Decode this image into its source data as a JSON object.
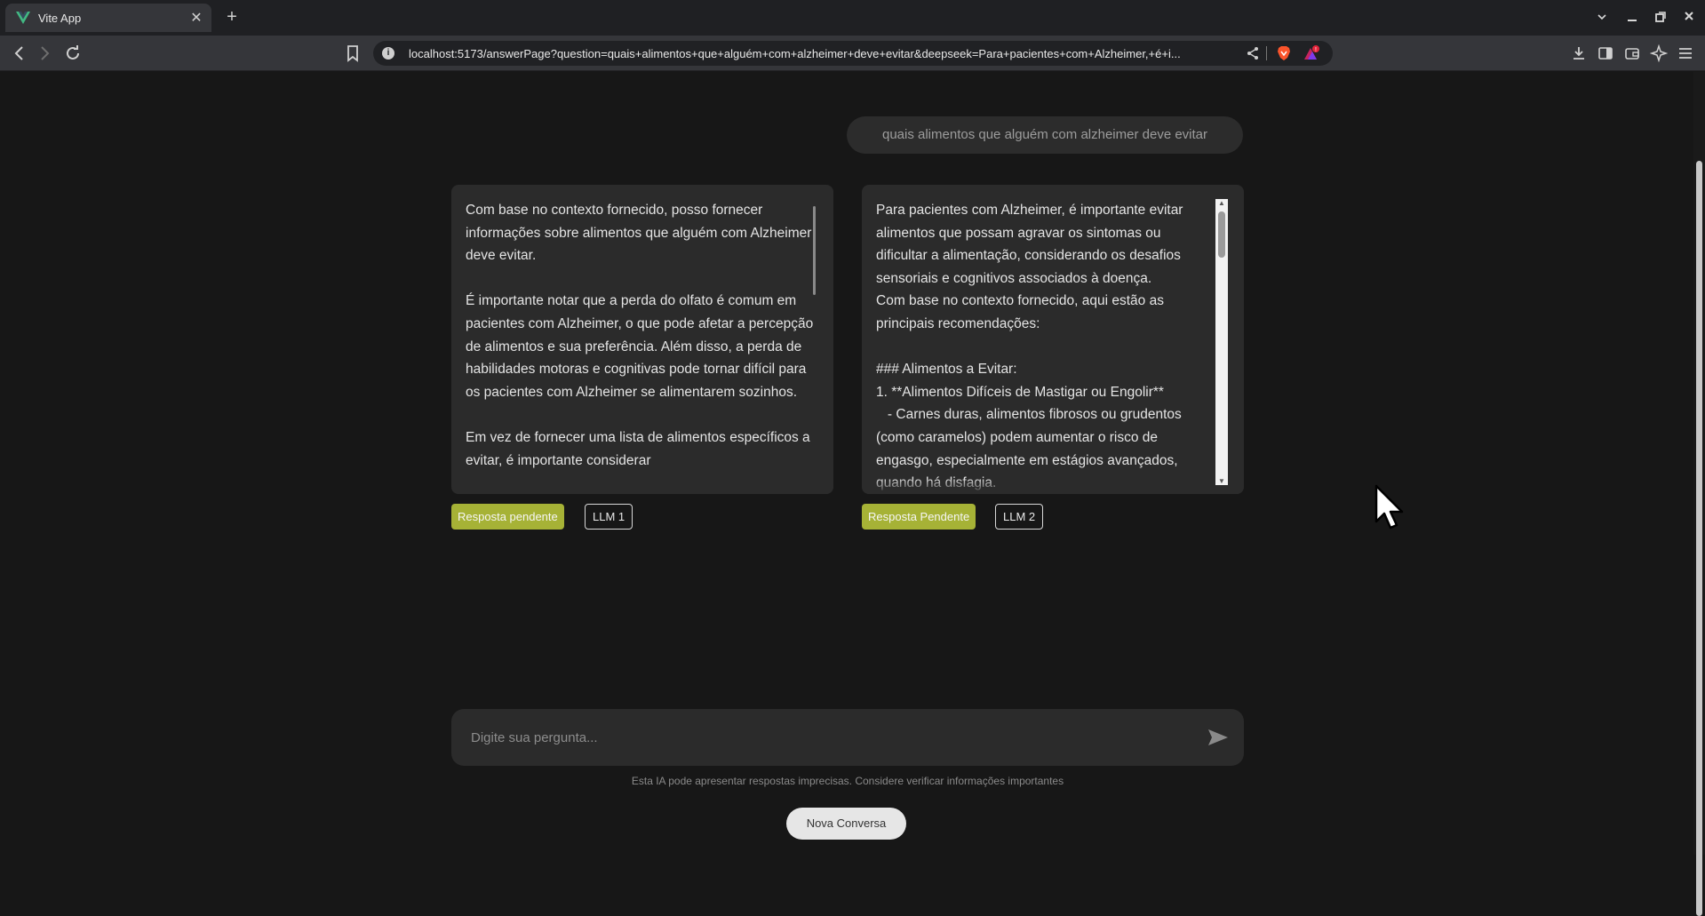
{
  "browser": {
    "tab_title": "Vite App",
    "url": "localhost:5173/answerPage?question=quais+alimentos+que+alguém+com+alzheimer+deve+evitar&deepseek=Para+pacientes+com+Alzheimer,+é+i...",
    "brave_badge": "!"
  },
  "chat": {
    "question": "quais alimentos que alguém com alzheimer deve evitar",
    "answers": [
      {
        "text": "Com base no contexto fornecido, posso fornecer informações sobre alimentos que alguém com Alzheimer deve evitar.\n\nÉ importante notar que a perda do olfato é comum em pacientes com Alzheimer, o que pode afetar a percepção de alimentos e sua preferência. Além disso, a perda de habilidades motoras e cognitivas pode tornar difícil para os pacientes com Alzheimer se alimentarem sozinhos.\n\nEm vez de fornecer uma lista de alimentos específicos a evitar, é importante considerar",
        "status": "Resposta pendente",
        "model": "LLM 1"
      },
      {
        "text": "Para pacientes com Alzheimer, é importante evitar alimentos que possam agravar os sintomas ou dificultar a alimentação, considerando os desafios sensoriais e cognitivos associados à doença.\nCom base no contexto fornecido, aqui estão as principais recomendações:\n\n### Alimentos a Evitar:\n1. **Alimentos Difíceis de Mastigar ou Engolir**\n   - Carnes duras, alimentos fibrosos ou grudentos (como caramelos) podem aumentar o risco de engasgo, especialmente em estágios avançados, quando há disfagia.",
        "status": "Resposta Pendente",
        "model": "LLM 2"
      }
    ],
    "input_placeholder": "Digite sua pergunta...",
    "disclaimer": "Esta IA pode apresentar respostas imprecisas. Considere verificar informações importantes",
    "new_chat_label": "Nova Conversa"
  }
}
